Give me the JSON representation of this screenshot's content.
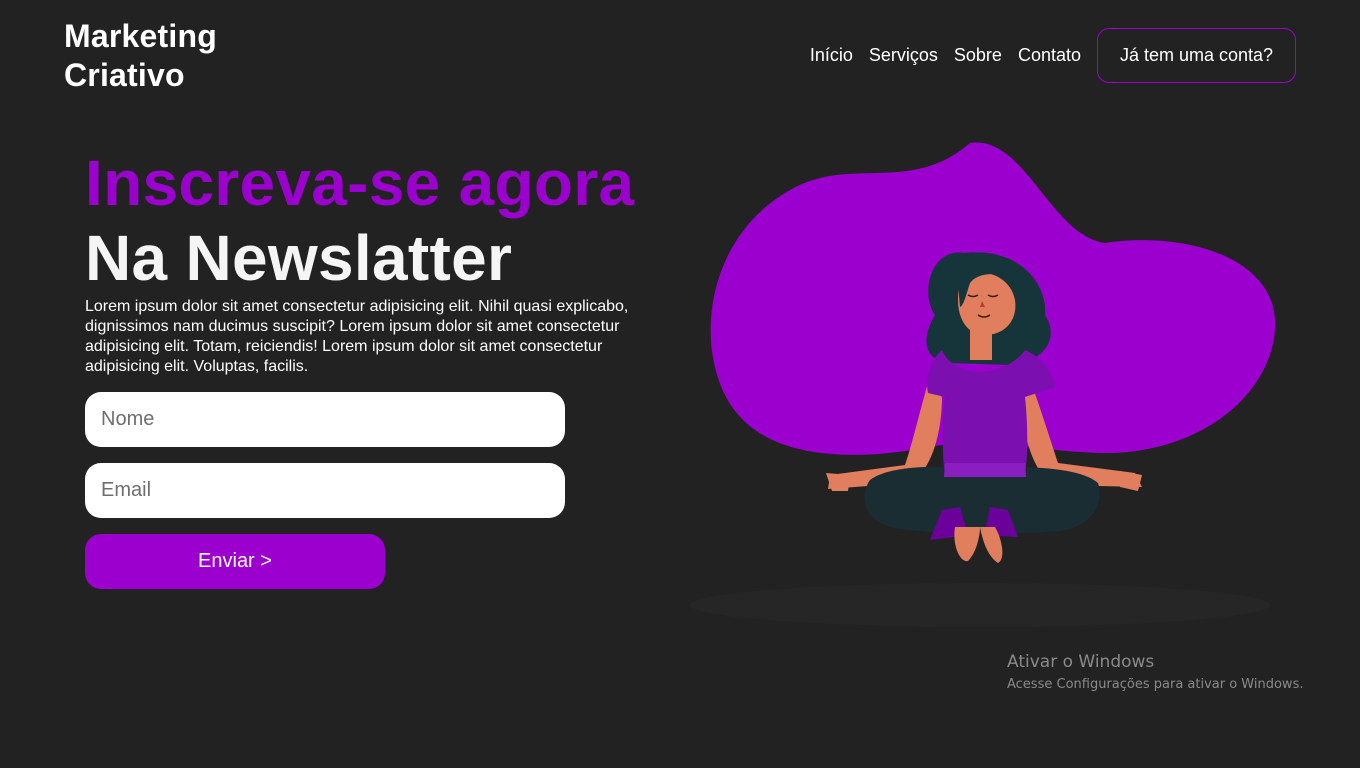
{
  "brand": {
    "line1": "Marketing",
    "line2": "Criativo"
  },
  "nav": {
    "items": [
      {
        "label": "Início"
      },
      {
        "label": "Serviços"
      },
      {
        "label": "Sobre"
      },
      {
        "label": "Contato"
      }
    ],
    "account_button": "Já tem uma conta?"
  },
  "hero": {
    "headline": "Inscreva-se agora",
    "subheadline": "Na Newslatter",
    "description": "Lorem ipsum dolor sit amet consectetur adipisicing elit. Nihil quasi explicabo, dignissimos nam ducimus suscipit? Lorem ipsum dolor sit amet consectetur adipisicing elit. Totam, reiciendis! Lorem ipsum dolor sit amet consectetur adipisicing elit. Voluptas, facilis."
  },
  "form": {
    "name_placeholder": "Nome",
    "name_value": "",
    "email_placeholder": "Email",
    "email_value": "",
    "submit_label": "Enviar >"
  },
  "illustration": {
    "icon": "meditating-woman-illustration"
  },
  "windows_watermark": {
    "title": "Ativar o Windows",
    "subtitle": "Acesse Configurações para ativar o Windows."
  },
  "colors": {
    "background": "#222223",
    "accent": "#9b00cf",
    "text": "#ffffff"
  }
}
